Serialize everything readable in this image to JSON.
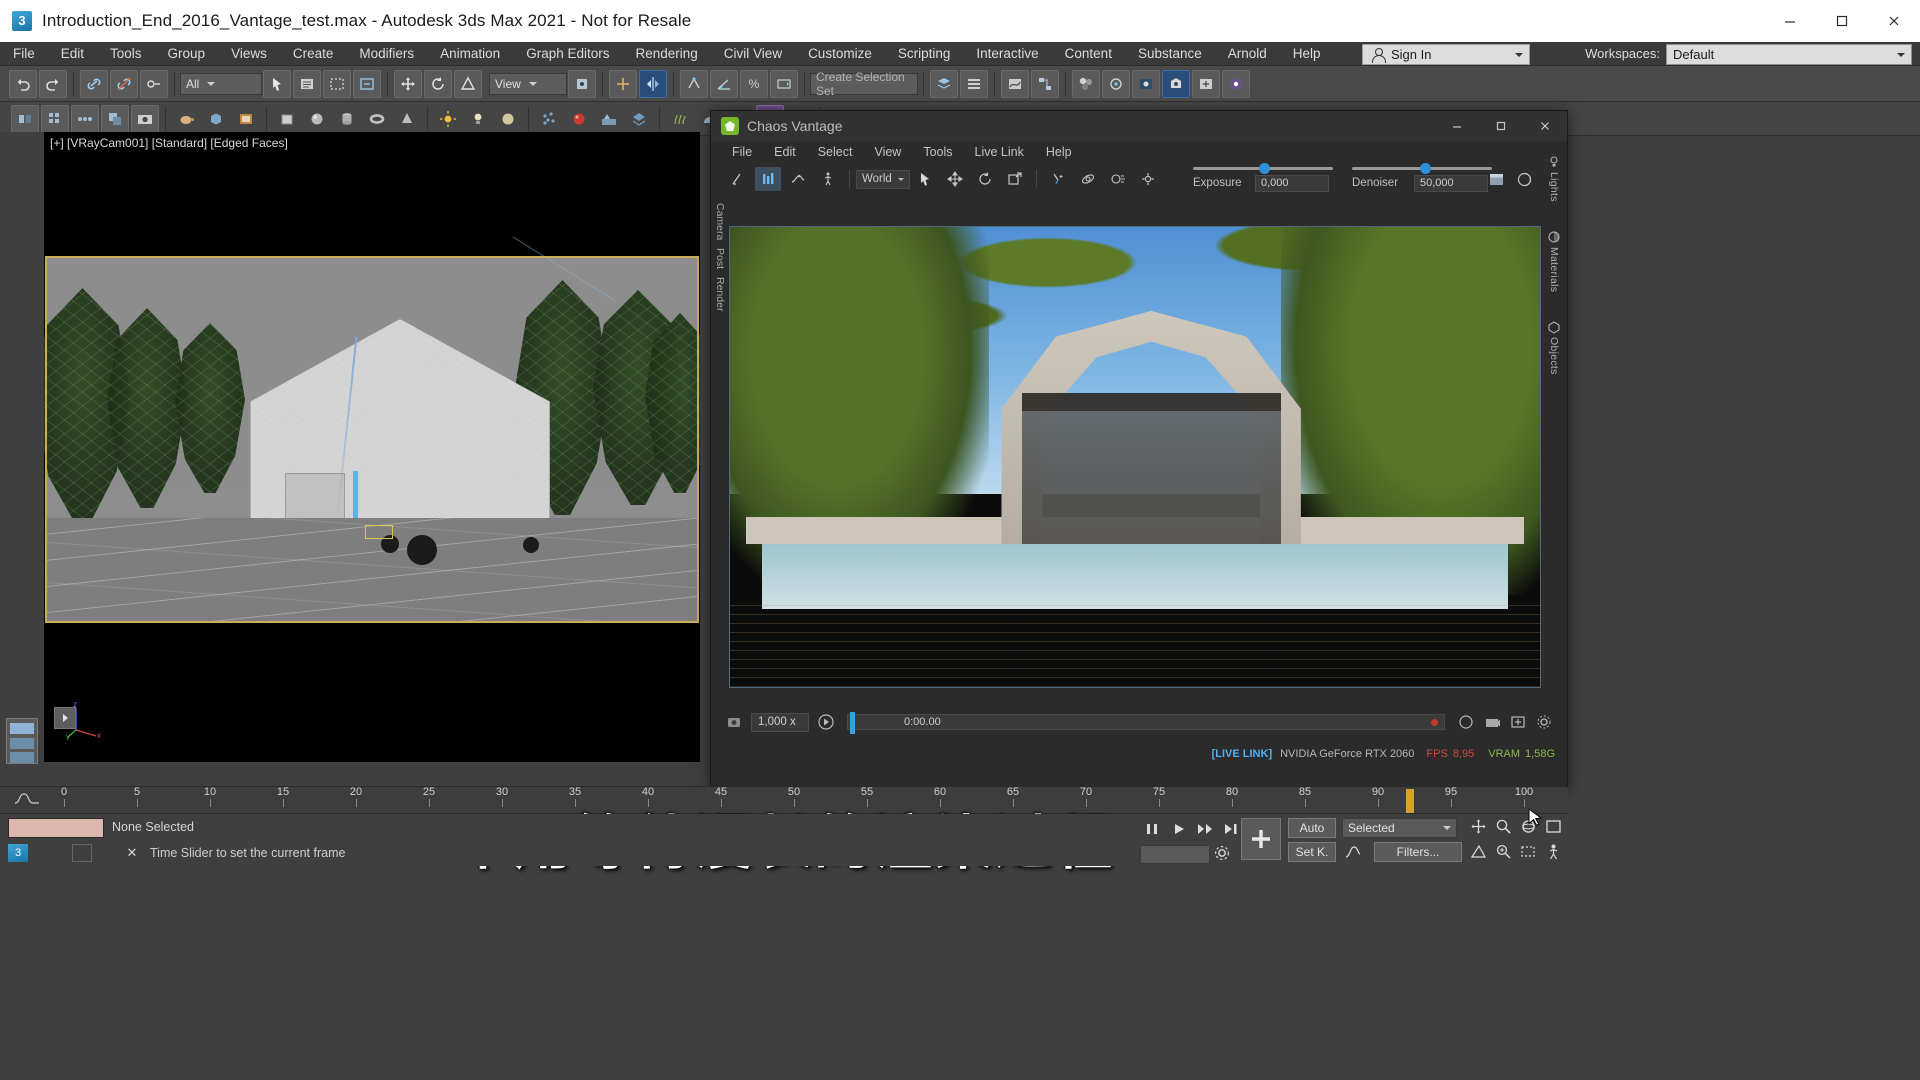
{
  "window": {
    "title": "Introduction_End_2016_Vantage_test.max - Autodesk 3ds Max 2021 - Not for Resale",
    "app_icon": "3dsmax-icon",
    "minimize": "minimize-icon",
    "maximize": "maximize-icon",
    "close": "close-icon"
  },
  "menubar": {
    "items": [
      "File",
      "Edit",
      "Tools",
      "Group",
      "Views",
      "Create",
      "Modifiers",
      "Animation",
      "Graph Editors",
      "Rendering",
      "Civil View",
      "Customize",
      "Scripting",
      "Interactive",
      "Content",
      "Substance",
      "Arnold",
      "Help"
    ],
    "sign_in": "Sign In",
    "workspaces_label": "Workspaces:",
    "workspace_value": "Default"
  },
  "toolbar": {
    "selection_filter": "All",
    "ref_coord_system": "View",
    "selection_set_placeholder": "Create Selection Set",
    "icons_row1": [
      "undo-icon",
      "redo-icon",
      "link-icon",
      "unlink-icon",
      "bind-space-warp-icon",
      "select-object-icon",
      "select-by-name-icon",
      "rect-select-icon",
      "window-crossing-icon",
      "select-move-icon",
      "select-rotate-icon",
      "select-scale-icon",
      "snaps-toggle-icon",
      "angle-snap-icon",
      "percent-snap-icon",
      "spinner-snap-icon",
      "named-selection-sets-icon",
      "mirror-icon",
      "align-icon",
      "layer-explorer-icon",
      "curve-editor-icon",
      "schematic-view-icon",
      "material-editor-icon",
      "render-setup-icon",
      "render-frame-window-icon",
      "render-production-icon",
      "render-iterative-icon",
      "active-shade-icon"
    ],
    "icons_row2": [
      "mirror-tool-icon",
      "array-tool-icon",
      "spacing-tool-icon",
      "clone-tool-icon",
      "snapshot-icon",
      "teapot-icon",
      "box-icon",
      "book-icon",
      "cube-icon",
      "sphere-icon",
      "cylinder-icon",
      "torus-icon",
      "cone-icon",
      "light-icon",
      "camera-icon",
      "sun-icon",
      "sphere-gizmo-icon",
      "particles-icon",
      "red-sphere-icon",
      "yellow-sphere-icon",
      "target-icon",
      "scatter-icon",
      "proxy-icon",
      "fur-icon",
      "vray-dome-icon",
      "vray-sphere-icon",
      "vray-plane-icon",
      "vray-light-icon",
      "rect-region-icon",
      "list-icon",
      "ring-icon"
    ]
  },
  "viewport": {
    "label": "[+] [VRayCam001] [Standard] [Edged Faces]",
    "axis_labels": [
      "z",
      "x",
      "y"
    ],
    "expand_icon": "expand-arrow-icon"
  },
  "vantage": {
    "title": "Chaos Vantage",
    "logo": "chaos-vantage-logo",
    "minimize": "minimize-icon",
    "maximize": "maximize-icon",
    "close": "close-icon",
    "menu": [
      "File",
      "Edit",
      "Select",
      "View",
      "Tools",
      "Live Link",
      "Help"
    ],
    "toolbar": {
      "coord_system": "World",
      "icons": [
        "measure-icon",
        "light-mix-icon",
        "keyframe-icon",
        "walk-mode-icon",
        "select-arrow-icon",
        "move-icon",
        "rotate-icon",
        "open-external-icon",
        "focus-picker-icon",
        "orbit-icon",
        "light-gizmo-icon",
        "pivot-icon",
        "screenshot-icon",
        "render-region-icon"
      ]
    },
    "exposure": {
      "label": "Exposure",
      "value": "0,000"
    },
    "denoiser": {
      "label": "Denoiser",
      "value": "50,000"
    },
    "left_rail": [
      "Camera",
      "Post",
      "Render"
    ],
    "right_rail": [
      "Lights",
      "Materials",
      "Objects"
    ],
    "timeline": {
      "record_icon": "record-keyframe-icon",
      "speed": "1,000 x",
      "play_icon": "play-icon",
      "current_time": "0:00.00",
      "loop_icon": "loop-icon",
      "camera_icon": "camera-icon",
      "export_icon": "export-icon",
      "settings_icon": "settings-icon"
    },
    "status": {
      "live_link": "[LIVE LINK]",
      "gpu": "NVIDIA GeForce RTX 2060",
      "fps_label": "FPS",
      "fps_value": "8,95",
      "vram_label": "VRAM",
      "vram_value": "1,58G"
    }
  },
  "trackbar": {
    "curve_icon": "curve-editor-icon",
    "ticks": [
      "0",
      "5",
      "10",
      "15",
      "20",
      "25",
      "30",
      "35",
      "40",
      "45",
      "50",
      "55",
      "60",
      "65",
      "70",
      "75",
      "80",
      "85",
      "90",
      "95",
      "100"
    ],
    "current_frame_position": "92"
  },
  "statusbar": {
    "selection_status": "None Selected",
    "prompt": "Time Slider to set the current frame",
    "maxscript_icon": "maxscript-mini-listener-icon",
    "lock_icon": "selection-lock-icon",
    "close_icon": "close-icon"
  },
  "animation_controls": {
    "auto_key": "Auto",
    "set_key": "Set K.",
    "selection_level": "Selected",
    "filters": "Filters...",
    "key_mode_icon": "key-mode-icon",
    "play_icon": "play-animation-icon",
    "next_frame_icon": "next-frame-icon",
    "end_frame_icon": "go-to-end-icon",
    "big_key_icon": "add-key-icon",
    "nav_icons": [
      "pan-icon",
      "zoom-icon",
      "orbit-icon",
      "maximize-viewport-icon",
      "field-of-view-icon",
      "zoom-extents-icon"
    ]
  },
  "subtitle": {
    "text": "不用等待漫长的渲染过程"
  },
  "cursor": {
    "icon": "mouse-cursor"
  },
  "colors": {
    "accent_blue": "#2f8fd8",
    "live_link": "#55b0f0",
    "fps_red": "#d04a3a",
    "vram_green": "#8fb84f",
    "viewport_border": "#c8b05a",
    "chrome_bg": "#3f3f3f"
  }
}
